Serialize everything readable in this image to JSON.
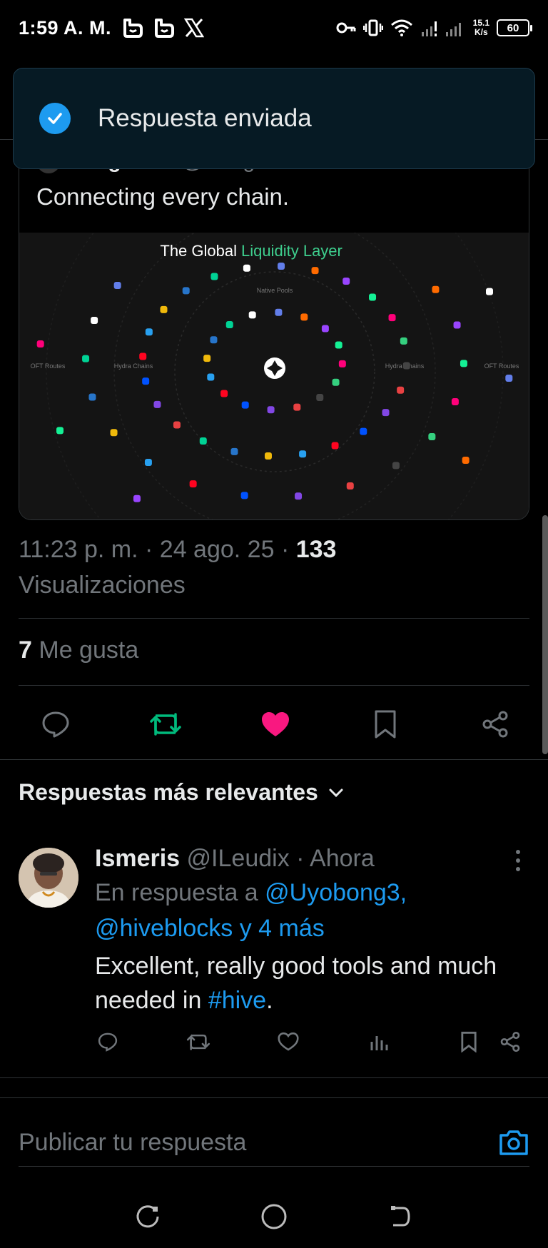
{
  "status_bar": {
    "time": "1:59 A. M.",
    "net_speed_value": "15.1",
    "net_speed_unit": "K/s",
    "battery": "60"
  },
  "toast": {
    "message": "Respuesta enviada"
  },
  "quoted_post": {
    "name": "Stargate",
    "handle": "@StargateFinan...",
    "age": "1d",
    "text": "Connecting every chain.",
    "image_title_1": "The Global",
    "image_title_2": "Liquidity Layer",
    "ring_labels": [
      "Native Pools",
      "Hydra Chains",
      "Hydra Chains",
      "OFT Routes",
      "OFT Routes"
    ]
  },
  "post_meta": {
    "time_date": "11:23 p. m. · 24 ago. 25 · ",
    "views_count": "133",
    "views_label": "Visualizaciones",
    "likes_count": "7",
    "likes_label": "Me gusta"
  },
  "replies_section": {
    "title": "Respuestas más relevantes"
  },
  "reply": {
    "name": "Ismeris",
    "handle": "@ILeudix",
    "separator": " · ",
    "time": "Ahora",
    "context_prefix": "En respuesta a ",
    "context_mention_1": "@Uyobong3,",
    "context_mention_2": "@hiveblocks y 4 más",
    "text_part_1": "Excellent, really good tools and much needed in ",
    "hashtag": "#hive",
    "text_part_2": "."
  },
  "composer": {
    "placeholder": "Publicar tu respuesta"
  },
  "colors": {
    "accent_blue": "#1d9bf0",
    "retweet_green": "#00ba7c",
    "like_pink": "#f91880",
    "muted": "#71767b",
    "toast_bg": "#061a24",
    "image_green": "#3ecf8e"
  }
}
